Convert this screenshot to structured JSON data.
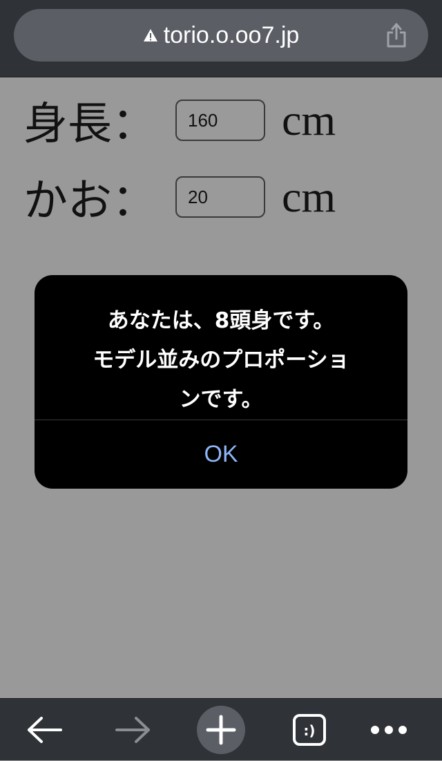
{
  "browser": {
    "url": "torio.o.oo7.jp",
    "icons": {
      "security": "warning-triangle-icon",
      "share": "share-icon",
      "back": "arrow-left-icon",
      "forward": "arrow-right-icon",
      "new_tab": "plus-icon",
      "tabs": "tabs-icon",
      "tabs_glyph": ":)",
      "menu": "more-dots-icon"
    }
  },
  "form": {
    "height": {
      "label": "身長：",
      "value": "160",
      "unit": "cm"
    },
    "face": {
      "label": "かお：",
      "value": "20",
      "unit": "cm"
    }
  },
  "dialog": {
    "message_lines": [
      "あなたは、8頭身です。",
      "モデル並みのプロポーショ",
      "ンです。"
    ],
    "ok_label": "OK"
  },
  "colors": {
    "page_background": "#999999",
    "toolbar": "#2f3236",
    "url_field": "#5b5e65",
    "dialog_background": "#000000",
    "dialog_button": "#8fb4f7",
    "forward_disabled": "#8a8d91"
  }
}
